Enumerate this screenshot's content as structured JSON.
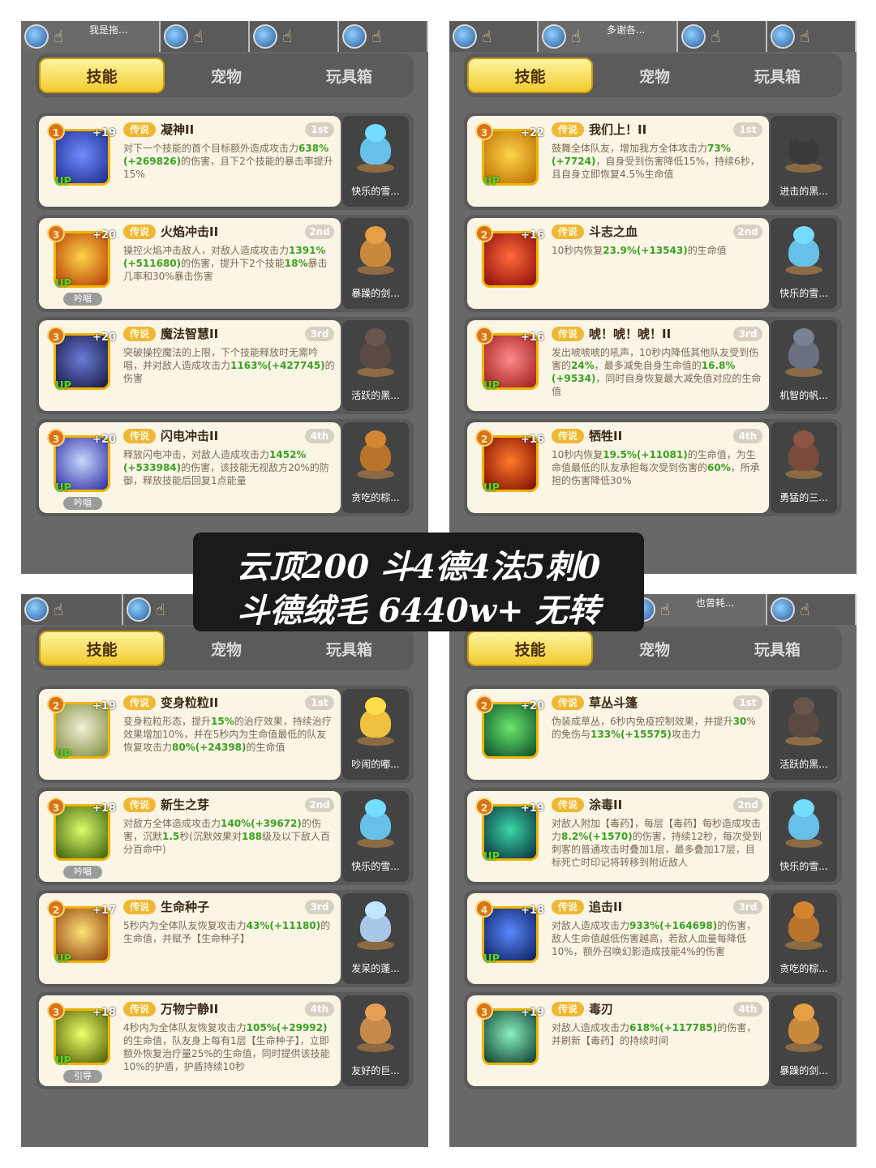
{
  "colors": {
    "tab_active": "#f1cc2e",
    "rarity": "#f0b733",
    "highlight": "#3aa020",
    "card_bg": "#fbf5e6"
  },
  "banner": {
    "line1": "云顶200 斗4德4法5刺0",
    "line2": "斗德绒毛 6440w+  无转"
  },
  "panels": [
    {
      "party": [
        {
          "name": "我是拖..."
        },
        {
          "name": ""
        },
        {
          "name": ""
        },
        {
          "name": ""
        }
      ],
      "tabs": [
        "技能",
        "宠物",
        "玩具箱"
      ],
      "cards": [
        {
          "level": "1",
          "plus": "+19",
          "up": "UP",
          "mode": "",
          "rarity": "传说",
          "name": "凝神II",
          "order": "1st",
          "desc": [
            {
              "t": "对下一个技能的首个目标额外造成攻击力"
            },
            {
              "t": "638%(+269826)",
              "g": true
            },
            {
              "t": "的伤害，且下2个技能的暴击率提升15%"
            }
          ],
          "pet": "快乐的雪...",
          "icon": "eye-swirl-icon",
          "c1": "#6f8cff",
          "c2": "#1a2a8a",
          "pc": "#66c0e8"
        },
        {
          "level": "3",
          "plus": "+20",
          "up": "UP",
          "mode": "吟唱",
          "rarity": "传说",
          "name": "火焰冲击II",
          "order": "2nd",
          "desc": [
            {
              "t": "操控火焰冲击敌人，对敌人造成攻击力"
            },
            {
              "t": "1391%(+511680)",
              "g": true
            },
            {
              "t": "的伤害，提升下2个技能"
            },
            {
              "t": "18%",
              "g": true
            },
            {
              "t": "暴击几率和30%暴击伤害"
            }
          ],
          "pet": "暴躁的剑...",
          "icon": "fire-burst-icon",
          "c1": "#ffd24a",
          "c2": "#b23a00",
          "pc": "#c88a3a"
        },
        {
          "level": "3",
          "plus": "+20",
          "up": "UP",
          "mode": "",
          "rarity": "传说",
          "name": "魔法智慧II",
          "order": "3rd",
          "desc": [
            {
              "t": "突破操控魔法的上限，下个技能释放时无需吟唱，并对敌人造成攻击力"
            },
            {
              "t": "1163%(+427745)",
              "g": true
            },
            {
              "t": "的伤害"
            }
          ],
          "pet": "活跃的黑...",
          "icon": "magic-hexagram-icon",
          "c1": "#6a7ad8",
          "c2": "#15183e",
          "pc": "#5a4a42"
        },
        {
          "level": "3",
          "plus": "+20",
          "up": "UP",
          "mode": "吟唱",
          "rarity": "传说",
          "name": "闪电冲击II",
          "order": "4th",
          "desc": [
            {
              "t": "释放闪电冲击，对敌人造成攻击力"
            },
            {
              "t": "1452%(+533984)",
              "g": true
            },
            {
              "t": "的伤害，该技能无视敌方20%的防御，释放技能后回复1点能量"
            }
          ],
          "pet": "贪吃的棕...",
          "icon": "lightning-bolt-icon",
          "c1": "#c8d8ff",
          "c2": "#2a2aa0",
          "pc": "#b8742a"
        }
      ]
    },
    {
      "party": [
        {
          "name": ""
        },
        {
          "name": "多谢各..."
        },
        {
          "name": ""
        },
        {
          "name": ""
        }
      ],
      "tabs": [
        "技能",
        "宠物",
        "玩具箱"
      ],
      "cards": [
        {
          "level": "3",
          "plus": "+22",
          "up": "UP",
          "mode": "",
          "rarity": "传说",
          "name": "我们上！II",
          "order": "1st",
          "desc": [
            {
              "t": "鼓舞全体队友，增加我方全体攻击力"
            },
            {
              "t": "73%(+7724)",
              "g": true
            },
            {
              "t": "，自身受到伤害降低15%，持续6秒，且自身立即恢复4.5%生命值"
            }
          ],
          "pet": "进击的黑...",
          "icon": "war-cry-icon",
          "c1": "#ffd54a",
          "c2": "#b86a00",
          "pc": "#3a3a3a"
        },
        {
          "level": "2",
          "plus": "+16",
          "up": "",
          "mode": "",
          "rarity": "传说",
          "name": "斗志之血",
          "order": "2nd",
          "desc": [
            {
              "t": "10秒内恢复"
            },
            {
              "t": "23.9%(+13543)",
              "g": true
            },
            {
              "t": "的生命值"
            }
          ],
          "pet": "快乐的雪...",
          "icon": "blood-fist-icon",
          "c1": "#ff6a3a",
          "c2": "#8a0a0a",
          "pc": "#66c0e8"
        },
        {
          "level": "3",
          "plus": "+16",
          "up": "UP",
          "mode": "",
          "rarity": "传说",
          "name": "唬！唬！唬！II",
          "order": "3rd",
          "desc": [
            {
              "t": "发出唬唬唬的吼声，10秒内降低其他队友受到伤害的"
            },
            {
              "t": "24%",
              "g": true
            },
            {
              "t": "，最多减免自身生命值的"
            },
            {
              "t": "16.8%(+9534)",
              "g": true
            },
            {
              "t": "，同时自身恢复最大减免值对应的生命值"
            }
          ],
          "pet": "机智的帆...",
          "icon": "roar-face-icon",
          "c1": "#ff8a8a",
          "c2": "#9a1a1a",
          "pc": "#6a7080"
        },
        {
          "level": "2",
          "plus": "+16",
          "up": "UP",
          "mode": "",
          "rarity": "传说",
          "name": "牺牲II",
          "order": "4th",
          "desc": [
            {
              "t": "10秒内恢复"
            },
            {
              "t": "19.5%(+11081)",
              "g": true
            },
            {
              "t": "的生命值，为生命值最低的队友承担每次受到伤害的"
            },
            {
              "t": "60%",
              "g": true
            },
            {
              "t": "，所承担的伤害降低30%"
            }
          ],
          "pet": "勇猛的三...",
          "icon": "sacrifice-figure-icon",
          "c1": "#ff7a2a",
          "c2": "#7a0a00",
          "pc": "#7a4a3a"
        }
      ]
    },
    {
      "party": [
        {
          "name": ""
        },
        {
          "name": ""
        },
        {
          "name": ""
        },
        {
          "name": ""
        }
      ],
      "tabs": [
        "技能",
        "宠物",
        "玩具箱"
      ],
      "cards": [
        {
          "level": "2",
          "plus": "+19",
          "up": "UP",
          "mode": "",
          "rarity": "传说",
          "name": "变身粒粒II",
          "order": "1st",
          "desc": [
            {
              "t": "变身粒粒形态，提升"
            },
            {
              "t": "15%",
              "g": true
            },
            {
              "t": "的治疗效果，持续治疗效果增加10%，并在5秒内为生命值最低的队友恢复攻击力"
            },
            {
              "t": "80%(+24398)",
              "g": true
            },
            {
              "t": "的生命值"
            }
          ],
          "pet": "吵闹的嘟...",
          "icon": "owl-form-icon",
          "c1": "#f5f0d8",
          "c2": "#7a8a3a",
          "pc": "#f0c040"
        },
        {
          "level": "3",
          "plus": "+18",
          "up": "",
          "mode": "吟唱",
          "rarity": "传说",
          "name": "新生之芽",
          "order": "2nd",
          "desc": [
            {
              "t": "对敌方全体造成攻击力"
            },
            {
              "t": "140%(+39672)",
              "g": true
            },
            {
              "t": "的伤害，沉默"
            },
            {
              "t": "1.5",
              "g": true
            },
            {
              "t": "秒(沉默效果对"
            },
            {
              "t": "188",
              "g": true
            },
            {
              "t": "级及以下敌人百分百命中)"
            }
          ],
          "pet": "快乐的雪...",
          "icon": "sprout-icon",
          "c1": "#d8ff6a",
          "c2": "#3a5a0a",
          "pc": "#66c0e8"
        },
        {
          "level": "2",
          "plus": "+17",
          "up": "UP",
          "mode": "",
          "rarity": "传说",
          "name": "生命种子",
          "order": "3rd",
          "desc": [
            {
              "t": "5秒内为全体队友恢复攻击力"
            },
            {
              "t": "43%(+11180)",
              "g": true
            },
            {
              "t": "的生命值，并赋予【生命种子】"
            }
          ],
          "pet": "发呆的蓬...",
          "icon": "life-seed-icon",
          "c1": "#ffe27a",
          "c2": "#8a3a0a",
          "pc": "#a8c8e8"
        },
        {
          "level": "3",
          "plus": "+18",
          "up": "UP",
          "mode": "引导",
          "rarity": "传说",
          "name": "万物宁静II",
          "order": "4th",
          "desc": [
            {
              "t": "4秒内为全体队友恢复攻击力"
            },
            {
              "t": "105%(+29992)",
              "g": true
            },
            {
              "t": "的生命值，队友身上每有1层【生命种子】，立即额外恢复治疗量25%的生命值，同时提供该技能10%的护盾，护盾持续10秒"
            }
          ],
          "pet": "友好的巨...",
          "icon": "glowing-flower-icon",
          "c1": "#f0ff6a",
          "c2": "#4a5a00",
          "pc": "#c88a4a"
        }
      ]
    },
    {
      "party": [
        {
          "name": ""
        },
        {
          "name": ""
        },
        {
          "name": "也曾耗..."
        },
        {
          "name": ""
        }
      ],
      "tabs": [
        "技能",
        "宠物",
        "玩具箱"
      ],
      "cards": [
        {
          "level": "2",
          "plus": "+20",
          "up": "",
          "mode": "",
          "rarity": "传说",
          "name": "草丛斗篷",
          "order": "1st",
          "desc": [
            {
              "t": "伪装成草丛，6秒内免疫控制效果，并提升"
            },
            {
              "t": "30",
              "g": true
            },
            {
              "t": "%的免伤与"
            },
            {
              "t": "133%(+15575)",
              "g": true
            },
            {
              "t": "攻击力"
            }
          ],
          "pet": "活跃的黑...",
          "icon": "bush-cloak-icon",
          "c1": "#6ae86a",
          "c2": "#0a4a2a",
          "pc": "#5a4a42"
        },
        {
          "level": "2",
          "plus": "+19",
          "up": "UP",
          "mode": "",
          "rarity": "传说",
          "name": "涂毒II",
          "order": "2nd",
          "desc": [
            {
              "t": "对敌人附加【毒药】，每层【毒药】每秒造成攻击力"
            },
            {
              "t": "8.2%(+1570)",
              "g": true
            },
            {
              "t": "的伤害，持续12秒，每次受到刺客的普通攻击时叠加1层，最多叠加17层，目标死亡时印记将转移到附近敌人"
            }
          ],
          "pet": "快乐的雪...",
          "icon": "poison-drop-icon",
          "c1": "#3ad8a8",
          "c2": "#0a2a3a",
          "pc": "#66c0e8"
        },
        {
          "level": "4",
          "plus": "+18",
          "up": "UP",
          "mode": "",
          "rarity": "传说",
          "name": "追击II",
          "order": "3rd",
          "desc": [
            {
              "t": "对敌人造成攻击力"
            },
            {
              "t": "933%(+164698)",
              "g": true
            },
            {
              "t": "的伤害，敌人生命值越低伤害越高，若敌人血量每降低10%，额外召唤幻影造成技能4%的伤害"
            }
          ],
          "pet": "贪吃的棕...",
          "icon": "pursuit-slash-icon",
          "c1": "#5a8aff",
          "c2": "#0a1a5a",
          "pc": "#b8742a"
        },
        {
          "level": "3",
          "plus": "+19",
          "up": "",
          "mode": "",
          "rarity": "传说",
          "name": "毒刃",
          "order": "4th",
          "desc": [
            {
              "t": "对敌人造成攻击力"
            },
            {
              "t": "618%(+117785)",
              "g": true
            },
            {
              "t": "的伤害，并刷新【毒药】的持续时间"
            }
          ],
          "pet": "暴躁的剑...",
          "icon": "skull-blade-icon",
          "c1": "#8af0c0",
          "c2": "#0a3a2a",
          "pc": "#c88a3a"
        }
      ]
    }
  ]
}
